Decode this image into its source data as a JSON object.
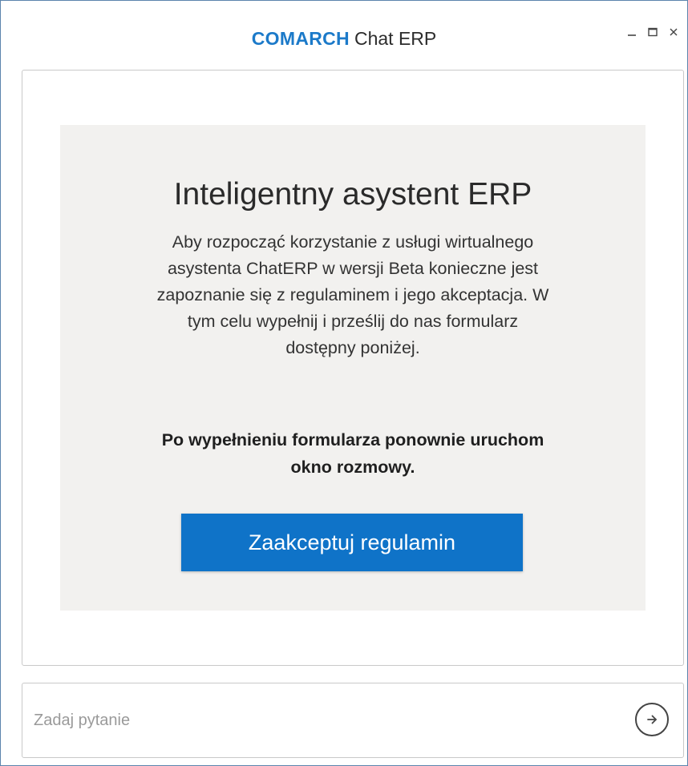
{
  "window": {
    "brand_logo": "COMARCH",
    "app_name": "Chat ERP",
    "controls": {
      "minimize": "minimize-icon",
      "maximize": "maximize-icon",
      "close": "close-icon"
    }
  },
  "card": {
    "title": "Inteligentny asystent ERP",
    "body_lines": [
      "Aby rozpocząć korzystanie z usługi wirtualnego",
      "asystenta ChatERP w wersji Beta konieczne jest",
      "zapoznanie się z regulaminem i jego akceptacja. W",
      "tym celu wypełnij i prześlij do nas formularz",
      "dostępny poniżej."
    ],
    "note_lines": [
      "Po wypełnieniu formularza ponownie uruchom",
      "okno rozmowy."
    ],
    "accept_button_label": "Zaakceptuj regulamin"
  },
  "chat_input": {
    "value": "",
    "placeholder": "Zadaj pytanie",
    "send_icon": "arrow-right-icon"
  },
  "colors": {
    "brand_blue": "#1c7ac9",
    "button_blue": "#0f73c8",
    "card_background": "#f2f1ef"
  }
}
